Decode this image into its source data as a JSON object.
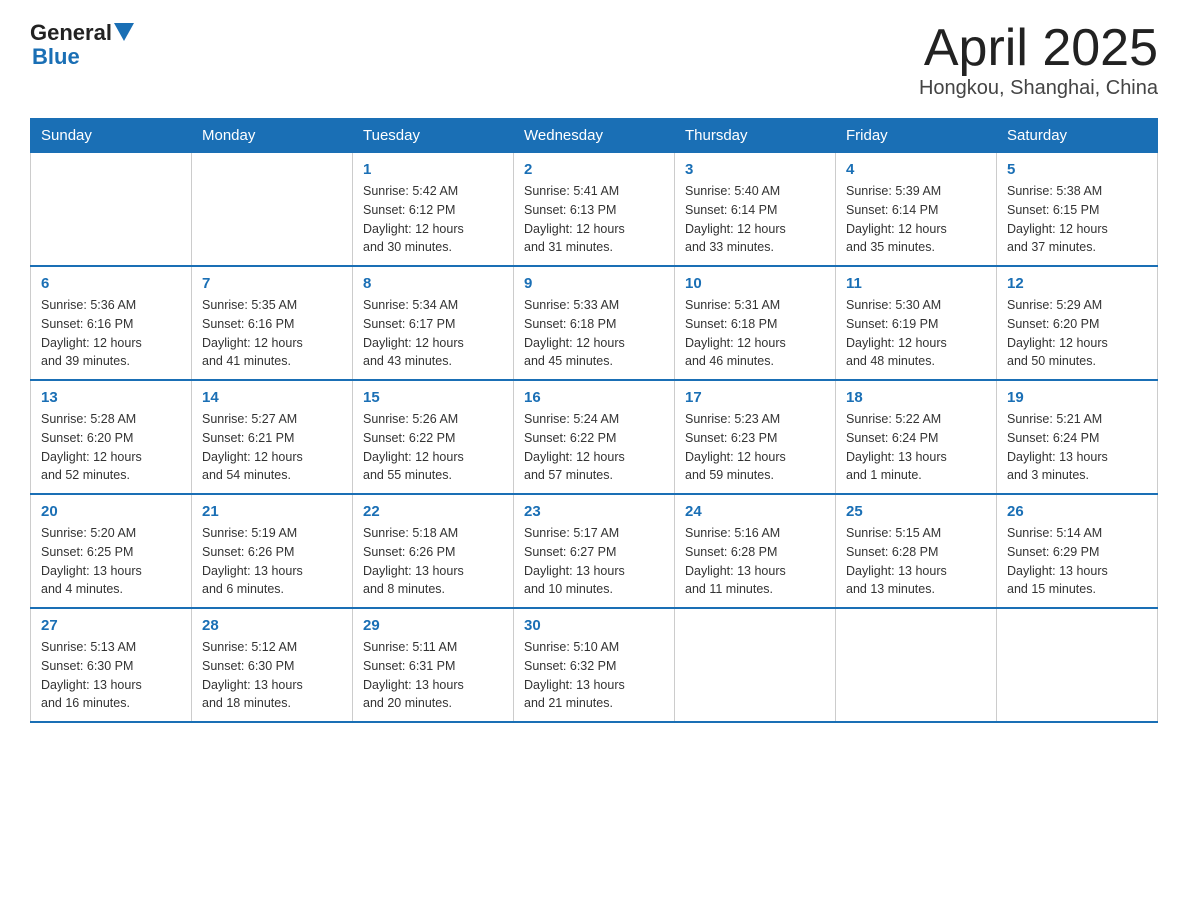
{
  "header": {
    "logo_general": "General",
    "logo_blue": "Blue",
    "title": "April 2025",
    "location": "Hongkou, Shanghai, China"
  },
  "days_of_week": [
    "Sunday",
    "Monday",
    "Tuesday",
    "Wednesday",
    "Thursday",
    "Friday",
    "Saturday"
  ],
  "weeks": [
    {
      "days": [
        {
          "num": "",
          "info": ""
        },
        {
          "num": "",
          "info": ""
        },
        {
          "num": "1",
          "info": "Sunrise: 5:42 AM\nSunset: 6:12 PM\nDaylight: 12 hours\nand 30 minutes."
        },
        {
          "num": "2",
          "info": "Sunrise: 5:41 AM\nSunset: 6:13 PM\nDaylight: 12 hours\nand 31 minutes."
        },
        {
          "num": "3",
          "info": "Sunrise: 5:40 AM\nSunset: 6:14 PM\nDaylight: 12 hours\nand 33 minutes."
        },
        {
          "num": "4",
          "info": "Sunrise: 5:39 AM\nSunset: 6:14 PM\nDaylight: 12 hours\nand 35 minutes."
        },
        {
          "num": "5",
          "info": "Sunrise: 5:38 AM\nSunset: 6:15 PM\nDaylight: 12 hours\nand 37 minutes."
        }
      ]
    },
    {
      "days": [
        {
          "num": "6",
          "info": "Sunrise: 5:36 AM\nSunset: 6:16 PM\nDaylight: 12 hours\nand 39 minutes."
        },
        {
          "num": "7",
          "info": "Sunrise: 5:35 AM\nSunset: 6:16 PM\nDaylight: 12 hours\nand 41 minutes."
        },
        {
          "num": "8",
          "info": "Sunrise: 5:34 AM\nSunset: 6:17 PM\nDaylight: 12 hours\nand 43 minutes."
        },
        {
          "num": "9",
          "info": "Sunrise: 5:33 AM\nSunset: 6:18 PM\nDaylight: 12 hours\nand 45 minutes."
        },
        {
          "num": "10",
          "info": "Sunrise: 5:31 AM\nSunset: 6:18 PM\nDaylight: 12 hours\nand 46 minutes."
        },
        {
          "num": "11",
          "info": "Sunrise: 5:30 AM\nSunset: 6:19 PM\nDaylight: 12 hours\nand 48 minutes."
        },
        {
          "num": "12",
          "info": "Sunrise: 5:29 AM\nSunset: 6:20 PM\nDaylight: 12 hours\nand 50 minutes."
        }
      ]
    },
    {
      "days": [
        {
          "num": "13",
          "info": "Sunrise: 5:28 AM\nSunset: 6:20 PM\nDaylight: 12 hours\nand 52 minutes."
        },
        {
          "num": "14",
          "info": "Sunrise: 5:27 AM\nSunset: 6:21 PM\nDaylight: 12 hours\nand 54 minutes."
        },
        {
          "num": "15",
          "info": "Sunrise: 5:26 AM\nSunset: 6:22 PM\nDaylight: 12 hours\nand 55 minutes."
        },
        {
          "num": "16",
          "info": "Sunrise: 5:24 AM\nSunset: 6:22 PM\nDaylight: 12 hours\nand 57 minutes."
        },
        {
          "num": "17",
          "info": "Sunrise: 5:23 AM\nSunset: 6:23 PM\nDaylight: 12 hours\nand 59 minutes."
        },
        {
          "num": "18",
          "info": "Sunrise: 5:22 AM\nSunset: 6:24 PM\nDaylight: 13 hours\nand 1 minute."
        },
        {
          "num": "19",
          "info": "Sunrise: 5:21 AM\nSunset: 6:24 PM\nDaylight: 13 hours\nand 3 minutes."
        }
      ]
    },
    {
      "days": [
        {
          "num": "20",
          "info": "Sunrise: 5:20 AM\nSunset: 6:25 PM\nDaylight: 13 hours\nand 4 minutes."
        },
        {
          "num": "21",
          "info": "Sunrise: 5:19 AM\nSunset: 6:26 PM\nDaylight: 13 hours\nand 6 minutes."
        },
        {
          "num": "22",
          "info": "Sunrise: 5:18 AM\nSunset: 6:26 PM\nDaylight: 13 hours\nand 8 minutes."
        },
        {
          "num": "23",
          "info": "Sunrise: 5:17 AM\nSunset: 6:27 PM\nDaylight: 13 hours\nand 10 minutes."
        },
        {
          "num": "24",
          "info": "Sunrise: 5:16 AM\nSunset: 6:28 PM\nDaylight: 13 hours\nand 11 minutes."
        },
        {
          "num": "25",
          "info": "Sunrise: 5:15 AM\nSunset: 6:28 PM\nDaylight: 13 hours\nand 13 minutes."
        },
        {
          "num": "26",
          "info": "Sunrise: 5:14 AM\nSunset: 6:29 PM\nDaylight: 13 hours\nand 15 minutes."
        }
      ]
    },
    {
      "days": [
        {
          "num": "27",
          "info": "Sunrise: 5:13 AM\nSunset: 6:30 PM\nDaylight: 13 hours\nand 16 minutes."
        },
        {
          "num": "28",
          "info": "Sunrise: 5:12 AM\nSunset: 6:30 PM\nDaylight: 13 hours\nand 18 minutes."
        },
        {
          "num": "29",
          "info": "Sunrise: 5:11 AM\nSunset: 6:31 PM\nDaylight: 13 hours\nand 20 minutes."
        },
        {
          "num": "30",
          "info": "Sunrise: 5:10 AM\nSunset: 6:32 PM\nDaylight: 13 hours\nand 21 minutes."
        },
        {
          "num": "",
          "info": ""
        },
        {
          "num": "",
          "info": ""
        },
        {
          "num": "",
          "info": ""
        }
      ]
    }
  ]
}
